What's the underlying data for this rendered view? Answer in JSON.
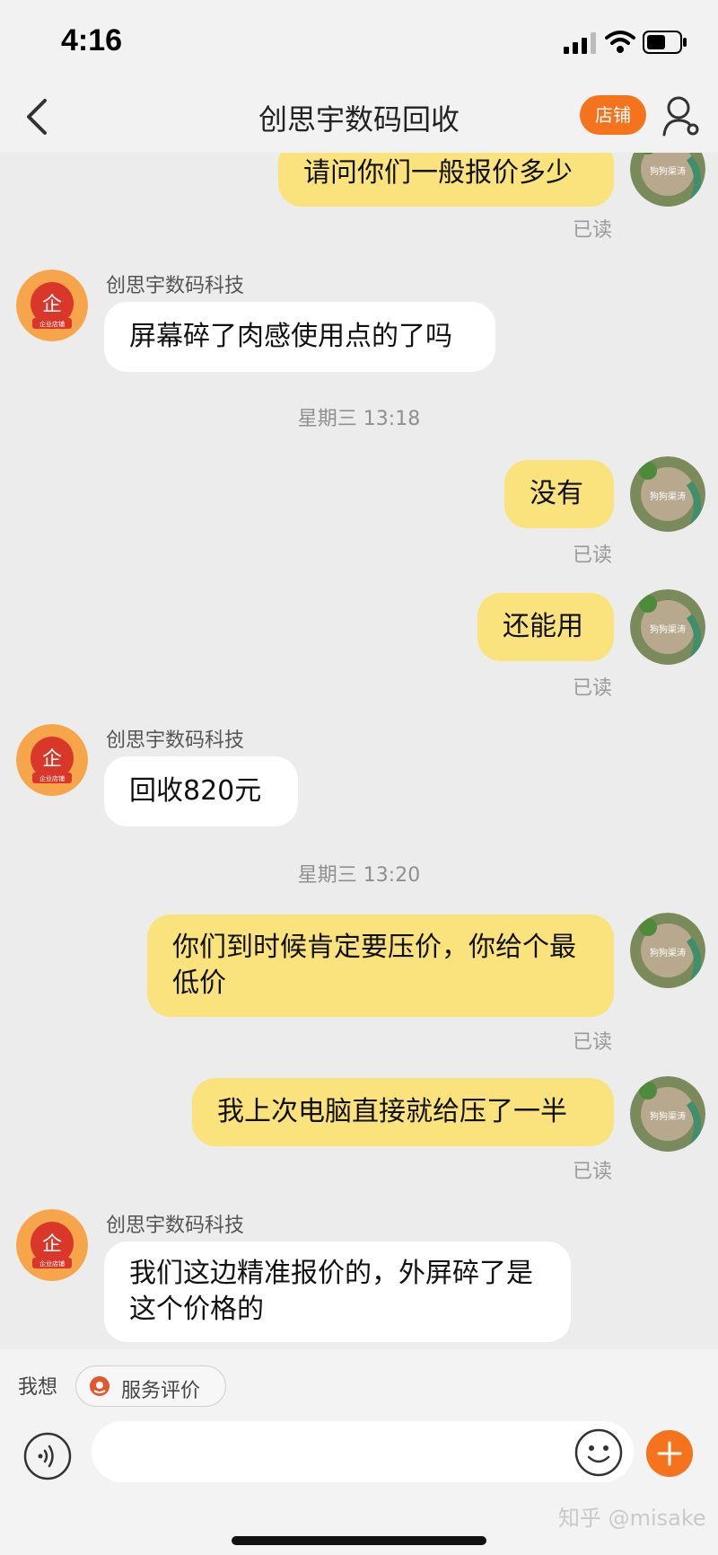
{
  "status": {
    "time": "4:16"
  },
  "nav": {
    "title": "创思宇数码回收",
    "shop_label": "店铺"
  },
  "chat": {
    "shop_name": "创思宇数码科技",
    "read_label": "已读",
    "messages": [
      {
        "side": "right",
        "text": "请问你们一般报价多少"
      },
      {
        "side": "left",
        "text": "屏幕碎了肉感使用点的了吗"
      },
      {
        "side": "right",
        "text": "没有"
      },
      {
        "side": "right",
        "text": "还能用"
      },
      {
        "side": "left",
        "text": "回收820元"
      },
      {
        "side": "right",
        "text": "你们到时候肯定要压价，你给个最低价"
      },
      {
        "side": "right",
        "text": "我上次电脑直接就给压了一半"
      },
      {
        "side": "left",
        "text": "我们这边精准报价的，外屏碎了是这个价格的"
      }
    ],
    "timestamps": [
      "星期三 13:18",
      "星期三 13:20"
    ],
    "avatar_text": "狗狗渠涛",
    "shop_badge": "企",
    "shop_badge_sub": "企业店铺"
  },
  "quick": {
    "label": "我想",
    "chip": "服务评价"
  },
  "input": {
    "placeholder": "",
    "value": ""
  },
  "watermark": "知乎 @misake",
  "colors": {
    "accent": "#f6731d",
    "my_bubble": "#fae27d",
    "their_bubble": "#ffffff",
    "background": "#ececec"
  }
}
